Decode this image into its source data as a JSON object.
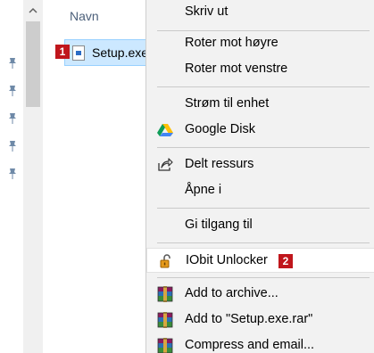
{
  "file_list": {
    "column_header": "Navn",
    "selected_file": "Setup.exe",
    "callout_1": "1"
  },
  "icons": {
    "pins": [
      "pin-icon",
      "pin-icon",
      "pin-icon",
      "pin-icon",
      "pin-icon"
    ],
    "scroll_up": "chevron-up-icon",
    "file": "exe-file-icon"
  },
  "context_menu": {
    "print": "Skriv ut",
    "rotate_right": "Roter mot høyre",
    "rotate_left": "Roter mot venstre",
    "cast": "Strøm til enhet",
    "google_drive": "Google Disk",
    "share": "Delt ressurs",
    "open_with": "Åpne i",
    "give_access": "Gi tilgang til",
    "iobit_unlocker": "IObit Unlocker",
    "callout_2": "2",
    "add_archive": "Add to archive...",
    "add_rar": "Add to \"Setup.exe.rar\"",
    "compress_email": "Compress and email..."
  },
  "colors": {
    "selection_bg": "#cce8ff",
    "selection_border": "#99d1ff",
    "callout_red": "#c0161c",
    "menu_bg": "#f2f2f2",
    "header_text": "#4c607a"
  }
}
